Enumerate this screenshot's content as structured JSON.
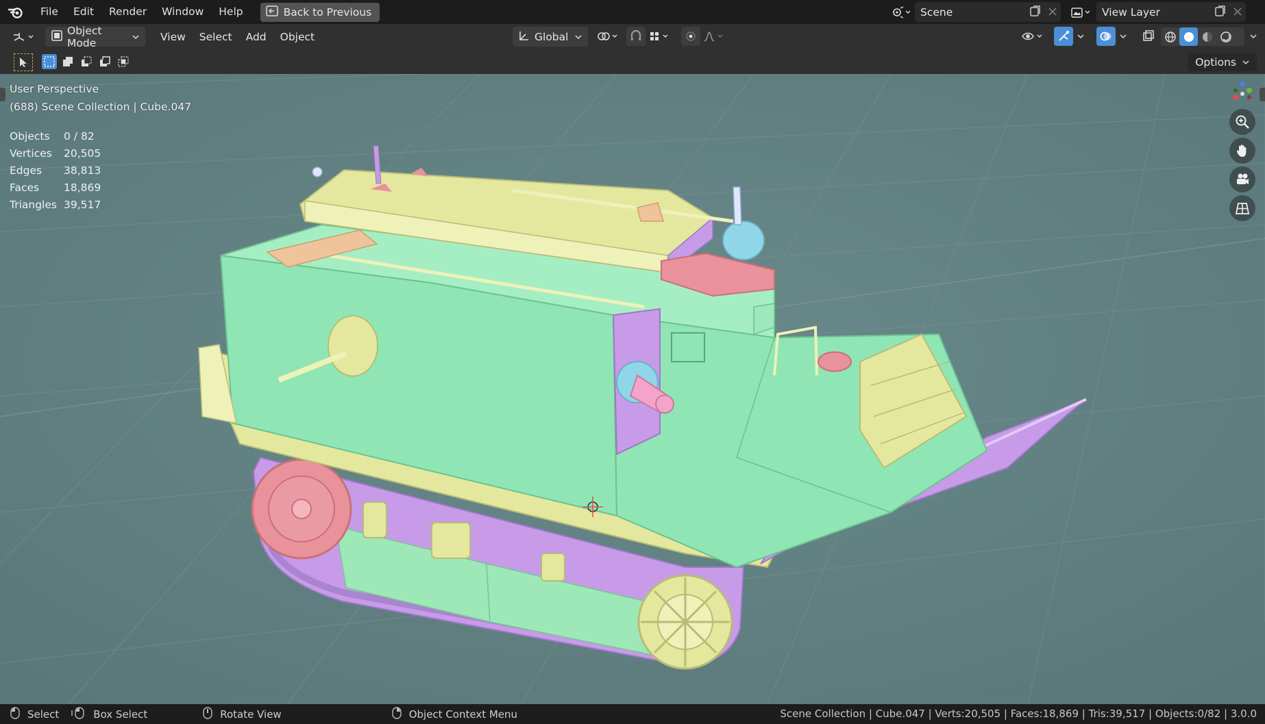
{
  "menu": {
    "items": [
      "File",
      "Edit",
      "Render",
      "Window",
      "Help"
    ],
    "back_button": "Back to Previous",
    "scene_name": "Scene",
    "view_layer": "View Layer"
  },
  "header": {
    "mode": "Object Mode",
    "menus": [
      "View",
      "Select",
      "Add",
      "Object"
    ],
    "orientation": "Global"
  },
  "toolbar": {
    "options_label": "Options"
  },
  "viewport": {
    "perspective": "User Perspective",
    "collection_line": "(688) Scene Collection | Cube.047",
    "stats": [
      {
        "label": "Objects",
        "value": "0 / 82"
      },
      {
        "label": "Vertices",
        "value": "20,505"
      },
      {
        "label": "Edges",
        "value": "38,813"
      },
      {
        "label": "Faces",
        "value": "18,869"
      },
      {
        "label": "Triangles",
        "value": "39,517"
      }
    ]
  },
  "statusbar": {
    "select": "Select",
    "box_select": "Box Select",
    "rotate_view": "Rotate View",
    "context_menu": "Object Context Menu",
    "info": "Scene Collection | Cube.047 | Verts:20,505 | Faces:18,869 | Tris:39,517 | Objects:0/82 | 3.0.0"
  },
  "colors": {
    "viewport_bg": "#5e7b7d",
    "tank_body": "#8fe6b4",
    "tank_rail": "#e4e89e",
    "tank_purple": "#c79be8",
    "tank_pink": "#e9929b",
    "accent_blue": "#4a8fd8"
  },
  "icons": [
    "blender-logo-icon",
    "back-icon",
    "scene-icon",
    "view-layer-icon",
    "editor-type-icon",
    "object-mode-icon",
    "transform-orientation-icon",
    "pivot-icon",
    "snap-icon",
    "proportional-icon",
    "visibility-icon",
    "gizmo-icon",
    "overlay-icon",
    "xray-icon",
    "shading-wire-icon",
    "shading-solid-icon",
    "shading-material-icon",
    "shading-render-icon",
    "zoom-icon",
    "hand-icon",
    "camera-icon",
    "grid-icon",
    "mouse-left-icon",
    "mouse-middle-icon",
    "mouse-right-icon"
  ]
}
